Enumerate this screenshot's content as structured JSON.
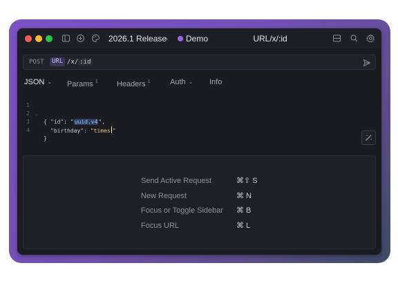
{
  "titlebar": {
    "traffic_colors": [
      "#fe5f57",
      "#febc2e",
      "#28c840"
    ],
    "icons": [
      "sidebar-toggle-icon",
      "plus-circle-icon",
      "palette-icon"
    ],
    "project": "2026.1 Release",
    "workspace": "Demo",
    "workspace_color": "#9d66e0",
    "title": "URL/x/:id",
    "right_icons": [
      "layout-icon",
      "search-icon",
      "gear-icon"
    ]
  },
  "urlbar": {
    "method": "POST",
    "url_tag": "URL",
    "path_text": "/x/",
    "path_param": ":id",
    "send_icon": "send-icon"
  },
  "tabs": [
    {
      "label": "JSON",
      "dropdown": true
    },
    {
      "label": "Params",
      "count": "1"
    },
    {
      "label": "Headers",
      "count": "1"
    },
    {
      "label": "Auth",
      "dropdown": true
    },
    {
      "label": "Info"
    }
  ],
  "editor": {
    "line_numbers": [
      "1",
      "2",
      "3",
      "4"
    ],
    "line1": "{",
    "line2_key": "\"id\"",
    "line2_colon": ": \"",
    "line2_tag": "uuid.v4",
    "line2_end": "\",",
    "line3_key": "\"birthday\"",
    "line3_colon": ": ",
    "line3_val_a": "\"times",
    "line3_val_b": "\"",
    "line4": "}"
  },
  "shortcuts": [
    {
      "label": "Send Active Request",
      "keys": "⌘⇧ S"
    },
    {
      "label": "New Request",
      "keys": "⌘ N"
    },
    {
      "label": "Focus or Toggle Sidebar",
      "keys": "⌘ B"
    },
    {
      "label": "Focus URL",
      "keys": "⌘ L"
    }
  ]
}
